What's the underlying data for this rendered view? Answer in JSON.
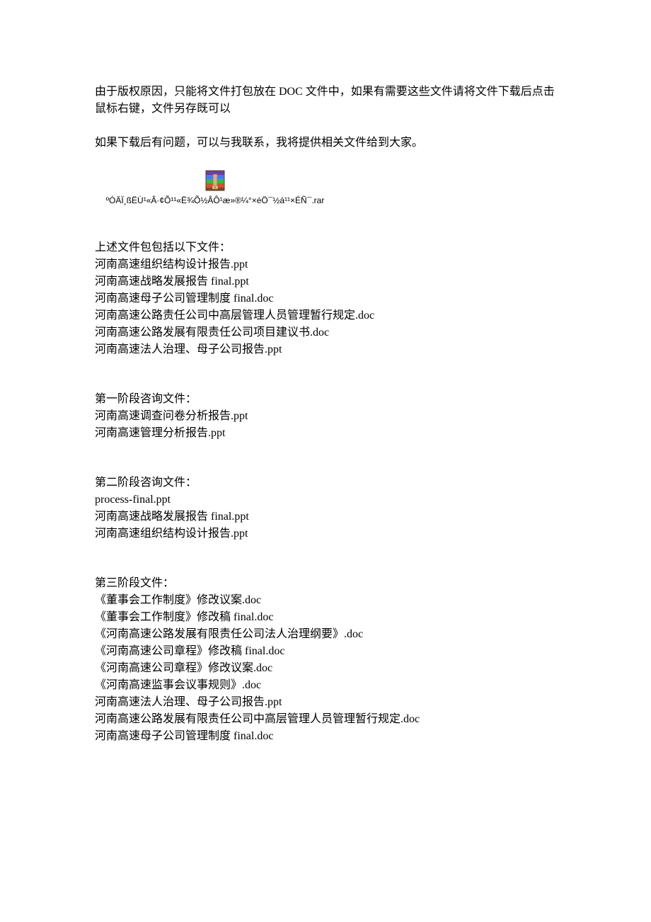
{
  "intro": {
    "p1": "由于版权原因，只能将文件打包放在 DOC 文件中，如果有需要这些文件请将文件下载后点击鼠标右键，文件另存既可以",
    "p2": "如果下载后有问题，可以与我联系，我将提供相关文件给到大家。"
  },
  "rar_filename": "ºÓÄÏ¸ßËÙ¹«Â·¢Õ¹¹«Ë¾Õ½ÂÔ¹æ»®¼°×éÖ¯½á¹¹×ÉÑ¯.rar",
  "section_main": {
    "heading": "上述文件包包括以下文件：",
    "files": [
      "河南高速组织结构设计报告.ppt",
      "河南高速战略发展报告 final.ppt",
      "河南高速母子公司管理制度 final.doc",
      "河南高速公路责任公司中高层管理人员管理暂行规定.doc",
      "河南高速公路发展有限责任公司项目建议书.doc",
      "河南高速法人治理、母子公司报告.ppt"
    ]
  },
  "section_phase1": {
    "heading": "第一阶段咨询文件：",
    "files": [
      "河南高速调查问卷分析报告.ppt",
      "河南高速管理分析报告.ppt"
    ]
  },
  "section_phase2": {
    "heading": "第二阶段咨询文件：",
    "files": [
      "process-final.ppt",
      "河南高速战略发展报告 final.ppt",
      "河南高速组织结构设计报告.ppt"
    ]
  },
  "section_phase3": {
    "heading": "第三阶段文件：",
    "files": [
      "《董事会工作制度》修改议案.doc",
      "《董事会工作制度》修改稿 final.doc",
      "《河南高速公路发展有限责任公司法人治理纲要》.doc",
      "《河南高速公司章程》修改稿 final.doc",
      "《河南高速公司章程》修改议案.doc",
      "《河南高速监事会议事规则》.doc",
      "河南高速法人治理、母子公司报告.ppt",
      "河南高速公路发展有限责任公司中高层管理人员管理暂行规定.doc",
      "河南高速母子公司管理制度 final.doc"
    ]
  }
}
